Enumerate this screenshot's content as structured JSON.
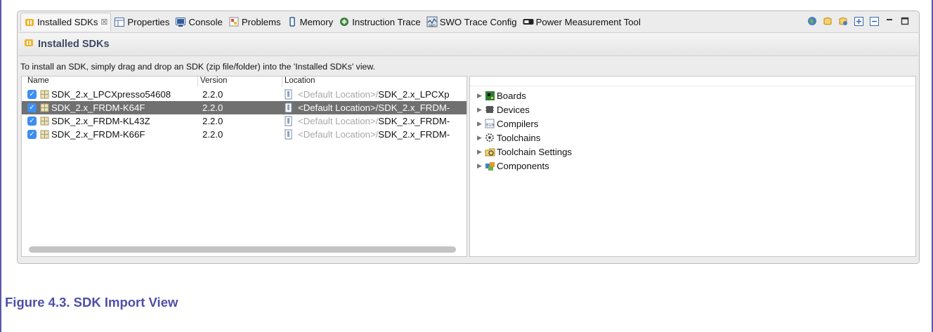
{
  "tabs": [
    {
      "label": "Installed SDKs",
      "icon": "installed-sdks-icon",
      "active": true,
      "close": "☒"
    },
    {
      "label": "Properties",
      "icon": "properties-icon"
    },
    {
      "label": "Console",
      "icon": "console-icon"
    },
    {
      "label": "Problems",
      "icon": "problems-icon"
    },
    {
      "label": "Memory",
      "icon": "memory-icon"
    },
    {
      "label": "Instruction Trace",
      "icon": "instruction-trace-icon"
    },
    {
      "label": "SWO Trace Config",
      "icon": "swo-trace-config-icon"
    },
    {
      "label": "Power Measurement Tool",
      "icon": "power-measurement-icon"
    }
  ],
  "view": {
    "title": "Installed SDKs",
    "instructions": "To install an SDK, simply drag and drop an SDK (zip file/folder) into the 'Installed SDKs' view."
  },
  "table": {
    "headers": {
      "name": "Name",
      "version": "Version",
      "location": "Location"
    },
    "rows": [
      {
        "name": "SDK_2.x_LPCXpresso54608",
        "version": "2.2.0",
        "location_default": "<Default Location>/",
        "location_path": "SDK_2.x_LPCXp",
        "checked": true,
        "selected": false
      },
      {
        "name": "SDK_2.x_FRDM-K64F",
        "version": "2.2.0",
        "location_default": "<Default Location>/",
        "location_path": "SDK_2.x_FRDM-",
        "checked": true,
        "selected": true
      },
      {
        "name": "SDK_2.x_FRDM-KL43Z",
        "version": "2.2.0",
        "location_default": "<Default Location>/",
        "location_path": "SDK_2.x_FRDM-",
        "checked": true,
        "selected": false
      },
      {
        "name": "SDK_2.x_FRDM-K66F",
        "version": "2.2.0",
        "location_default": "<Default Location>/",
        "location_path": "SDK_2.x_FRDM-",
        "checked": true,
        "selected": false
      }
    ]
  },
  "tree": {
    "items": [
      {
        "label": "Boards",
        "icon": "boards-icon"
      },
      {
        "label": "Devices",
        "icon": "devices-icon"
      },
      {
        "label": "Compilers",
        "icon": "compilers-icon"
      },
      {
        "label": "Toolchains",
        "icon": "toolchains-icon"
      },
      {
        "label": "Toolchain Settings",
        "icon": "toolchain-settings-icon"
      },
      {
        "label": "Components",
        "icon": "components-icon"
      }
    ]
  },
  "caption": "Figure 4.3. SDK Import View",
  "colors": {
    "selection": "#707070",
    "checkbox": "#3d8ef2",
    "caption": "#4d4fa8",
    "view_title": "#3c4a63",
    "frame_border": "#5a58a8"
  }
}
